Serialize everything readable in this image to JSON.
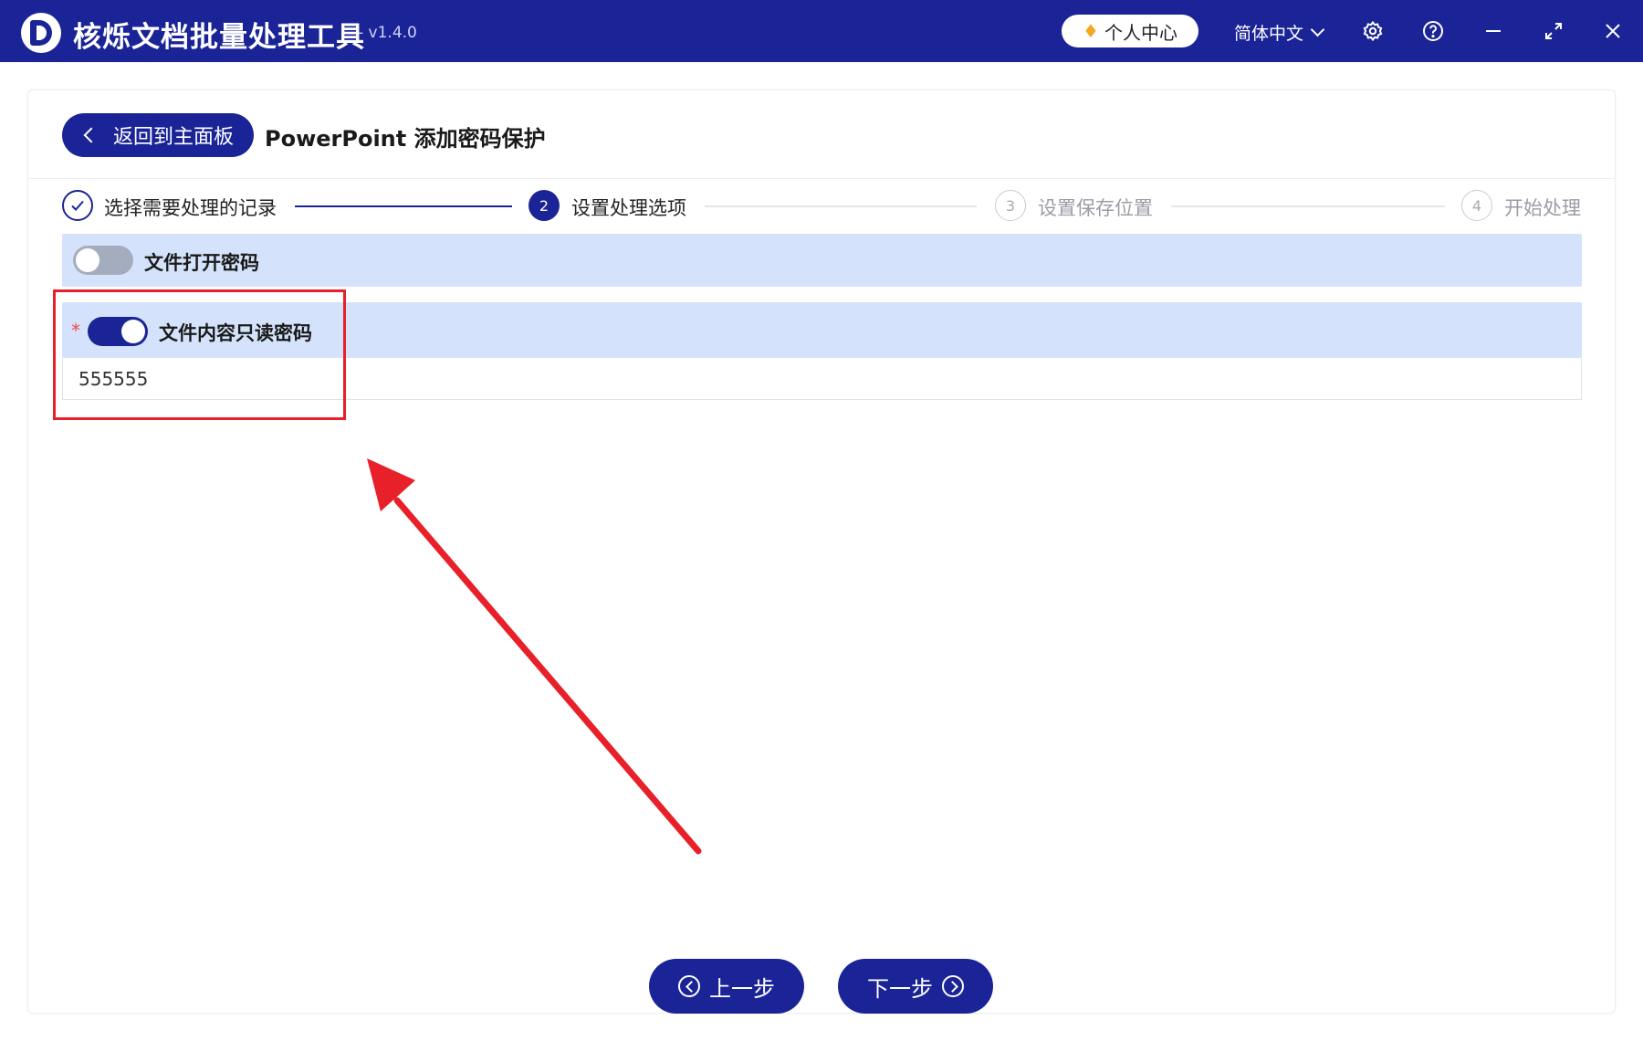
{
  "window": {
    "title": "核烁文档批量处理工具",
    "version": "- v1.4.0",
    "user_center": "个人中心",
    "language": "简体中文",
    "icons": [
      "settings-icon",
      "help-icon",
      "minimize-icon",
      "maximize-icon",
      "close-icon"
    ]
  },
  "header": {
    "back_label": "返回到主面板",
    "page_title": "PowerPoint 添加密码保护"
  },
  "steps": [
    {
      "number": "",
      "label": "选择需要处理的记录",
      "state": "done"
    },
    {
      "number": "2",
      "label": "设置处理选项",
      "state": "active"
    },
    {
      "number": "3",
      "label": "设置保存位置",
      "state": "pending"
    },
    {
      "number": "4",
      "label": "开始处理",
      "state": "pending"
    }
  ],
  "options": {
    "open_password": {
      "label": "文件打开密码",
      "enabled": false
    },
    "readonly_password": {
      "label": "文件内容只读密码",
      "enabled": true,
      "required_mark": "*",
      "value": "555555"
    }
  },
  "footer": {
    "prev_label": "上一步",
    "next_label": "下一步"
  },
  "colors": {
    "primary": "#1b2496",
    "option_bg": "#d4e3fb",
    "annotation": "#e8202a"
  }
}
